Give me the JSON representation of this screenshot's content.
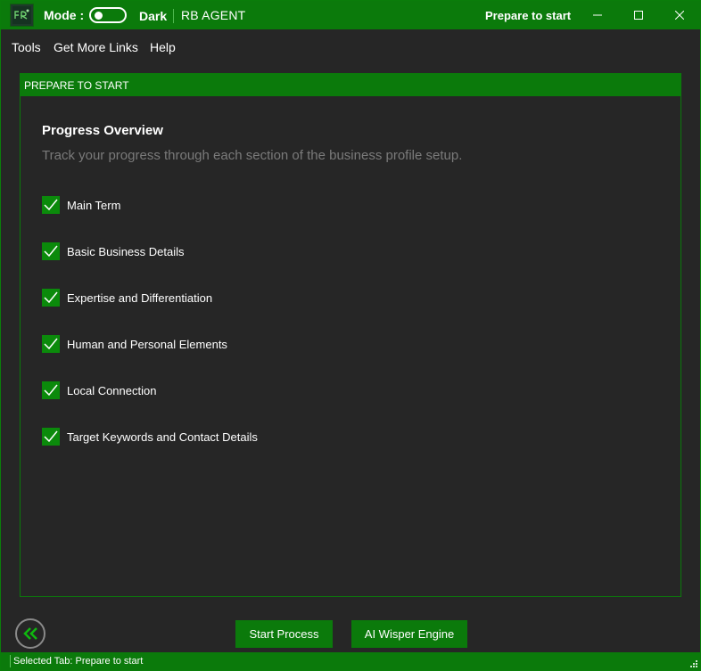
{
  "titlebar": {
    "mode_label": "Mode :",
    "dark_label": "Dark",
    "app_name": "RB AGENT",
    "window_title": "Prepare to start",
    "toggle_on": false
  },
  "menu": {
    "tools": "Tools",
    "get_more_links": "Get More Links",
    "help": "Help"
  },
  "panel": {
    "header": "PREPARE TO START",
    "title": "Progress Overview",
    "description": "Track your progress through each section of the business profile setup.",
    "items": [
      {
        "label": "Main Term",
        "checked": true
      },
      {
        "label": "Basic Business Details",
        "checked": true
      },
      {
        "label": "Expertise and Differentiation",
        "checked": true
      },
      {
        "label": "Human and Personal Elements",
        "checked": true
      },
      {
        "label": "Local Connection",
        "checked": true
      },
      {
        "label": "Target Keywords and Contact Details",
        "checked": true
      }
    ]
  },
  "actions": {
    "start_process": "Start Process",
    "ai_wisper_engine": "AI Wisper Engine"
  },
  "status": {
    "text": "Selected Tab:  Prepare to start"
  },
  "colors": {
    "accent": "#0b7a0b",
    "background": "#262626",
    "muted_text": "#7a7a7a"
  },
  "icons": {
    "app": "app-logo-icon",
    "minimize": "minimize-icon",
    "maximize": "maximize-icon",
    "close": "close-icon",
    "checkbox": "checkmark-icon",
    "back": "double-chevron-left-icon",
    "grip": "resize-grip-icon"
  }
}
